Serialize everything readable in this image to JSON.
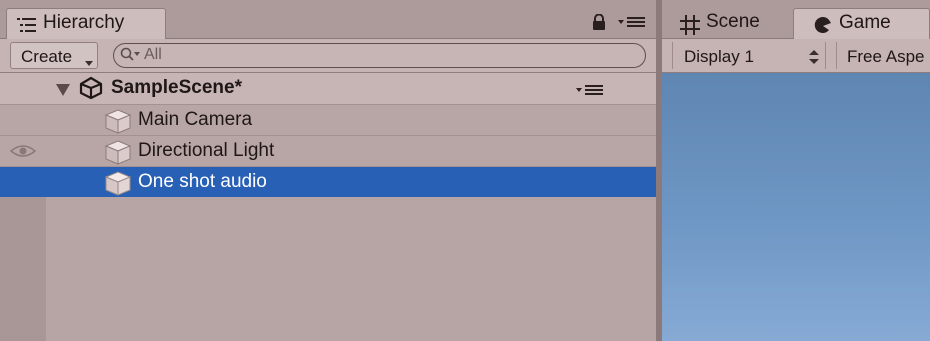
{
  "hierarchy": {
    "tab_label": "Hierarchy",
    "toolbar": {
      "create_label": "Create",
      "search_placeholder": "All"
    },
    "scene": {
      "name": "SampleScene*"
    },
    "items": [
      {
        "label": "Main Camera",
        "selected": false,
        "visible_eye": false
      },
      {
        "label": "Directional Light",
        "selected": false,
        "visible_eye": true
      },
      {
        "label": "One shot audio",
        "selected": true,
        "visible_eye": false
      }
    ]
  },
  "scene_tab": {
    "label": "Scene"
  },
  "game_tab": {
    "label": "Game",
    "display_select": "Display 1",
    "aspect_select": "Free Aspe"
  },
  "colors": {
    "selection": "#2860b6",
    "game_view_top": "#5f86b2",
    "game_view_bottom": "#86aad4"
  },
  "icons": [
    "hierarchy-lines-icon",
    "lock-icon",
    "panel-menu-icon",
    "search-icon",
    "fold-arrow-icon",
    "unity-logo-icon",
    "cube-icon",
    "eye-icon",
    "grid-icon",
    "game-pacman-icon",
    "updown-arrows-icon"
  ]
}
